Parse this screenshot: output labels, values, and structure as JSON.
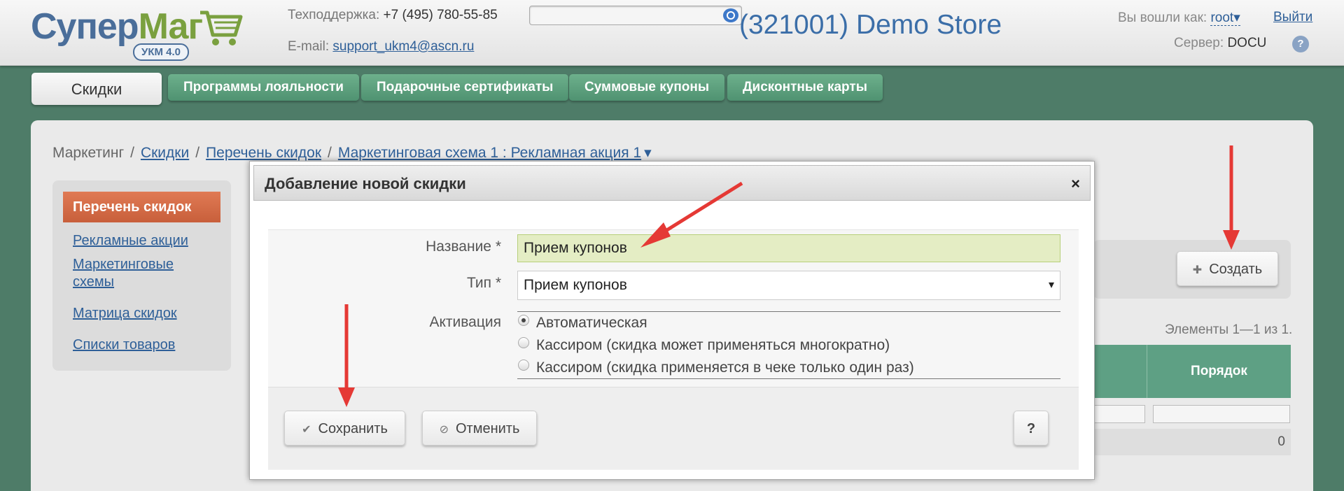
{
  "header": {
    "logo_part1": "Супер",
    "logo_part2": "Маг",
    "logo_badge": "УКМ 4.0",
    "support_label": "Техподдержка:",
    "support_phone": "+7 (495) 780-55-85",
    "email_label": "E-mail:",
    "email": "support_ukm4@ascn.ru",
    "search_placeholder": "",
    "store_title": "(321001) Demo Store",
    "login_label": "Вы вошли как:",
    "user": "root",
    "user_caret": "▾",
    "logout": "Выйти",
    "server_label": "Сервер:",
    "server": "DOCU",
    "help": "?"
  },
  "tabs": [
    {
      "label": "Скидки"
    },
    {
      "label": "Программы лояльности"
    },
    {
      "label": "Подарочные сертификаты"
    },
    {
      "label": "Суммовые купоны"
    },
    {
      "label": "Дисконтные карты"
    }
  ],
  "breadcrumb": {
    "root": "Маркетинг",
    "sep": "/",
    "items": [
      "Скидки",
      "Перечень скидок",
      "Маркетинговая схема 1 : Рекламная акция 1"
    ],
    "caret": "▾"
  },
  "sidebar": {
    "active": "Перечень скидок",
    "items": [
      "Рекламные акции",
      "Маркетинговые",
      "схемы",
      "Матрица скидок",
      "Списки товаров"
    ]
  },
  "list": {
    "create_icon": "plus-icon",
    "create_label": "Создать",
    "counter": "Элементы 1—1 из 1.",
    "column_order": "Порядок",
    "row_value": "0"
  },
  "modal": {
    "title": "Добавление новой скидки",
    "close": "×",
    "name_label": "Название *",
    "name_value": "Прием купонов",
    "type_label": "Тип *",
    "type_value": "Прием купонов",
    "type_caret": "▾",
    "activation_label": "Активация",
    "activation_options": [
      {
        "label": "Автоматическая",
        "checked": true
      },
      {
        "label": "Кассиром (скидка может применяться многократно)",
        "checked": false
      },
      {
        "label": "Кассиром (скидка применяется в чеке только один раз)",
        "checked": false
      }
    ],
    "save_icon": "check-icon",
    "save_label": "Сохранить",
    "cancel_icon": "cancel-icon",
    "cancel_label": "Отменить",
    "help_label": "?"
  },
  "colors": {
    "background": "#4e7c68",
    "tab_green": "#5ea084",
    "active_side": "#d46a45",
    "link": "#2e5f98",
    "arrow": "#e53935"
  }
}
